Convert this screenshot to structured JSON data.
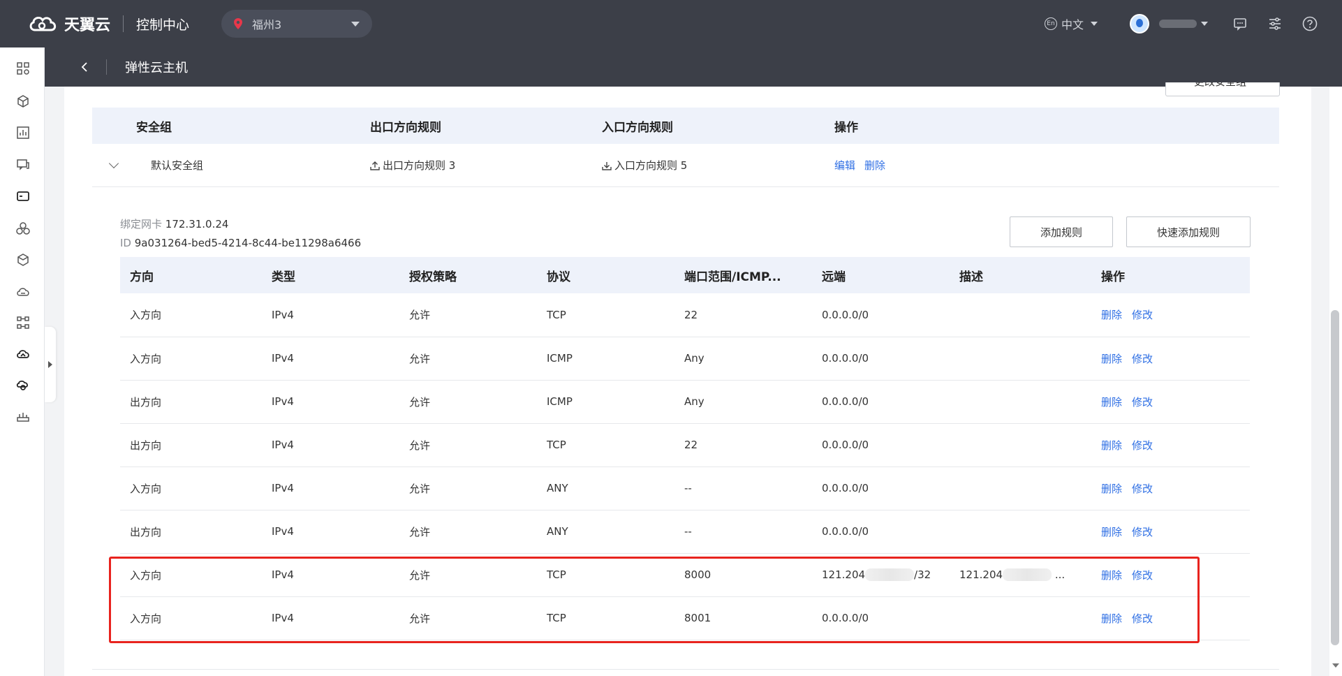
{
  "topbar": {
    "brand": "天翼云",
    "console_title": "控制中心",
    "region": "福州3",
    "language": "中文",
    "lang_badge": "En"
  },
  "subheader": {
    "title": "弹性云主机"
  },
  "top_button_partial": "更改安全组",
  "security_group": {
    "headers": [
      "安全组",
      "出口方向规则",
      "入口方向规则",
      "操作"
    ],
    "row": {
      "name": "默认安全组",
      "egress_rules": "出口方向规则 3",
      "ingress_rules": "入口方向规则 5",
      "edit": "编辑",
      "delete": "删除"
    }
  },
  "nic": {
    "label": "绑定网卡",
    "ip": "172.31.0.24",
    "id_label": "ID",
    "id": "9a031264-bed5-4214-8c44-be11298a6466"
  },
  "buttons": {
    "add_rule": "添加规则",
    "quick_add_rule": "快速添加规则"
  },
  "rules_table": {
    "headers": [
      "方向",
      "类型",
      "授权策略",
      "协议",
      "端口范围/ICMP...",
      "远端",
      "描述",
      "操作"
    ],
    "delete_label": "删除",
    "modify_label": "修改",
    "rows": [
      {
        "direction": "入方向",
        "type": "IPv4",
        "policy": "允许",
        "protocol": "TCP",
        "port": "22",
        "remote": "0.0.0.0/0",
        "remote_suffix": "",
        "desc": "",
        "desc_suffix": ""
      },
      {
        "direction": "入方向",
        "type": "IPv4",
        "policy": "允许",
        "protocol": "ICMP",
        "port": "Any",
        "remote": "0.0.0.0/0",
        "remote_suffix": "",
        "desc": "",
        "desc_suffix": ""
      },
      {
        "direction": "出方向",
        "type": "IPv4",
        "policy": "允许",
        "protocol": "ICMP",
        "port": "Any",
        "remote": "0.0.0.0/0",
        "remote_suffix": "",
        "desc": "",
        "desc_suffix": ""
      },
      {
        "direction": "出方向",
        "type": "IPv4",
        "policy": "允许",
        "protocol": "TCP",
        "port": "22",
        "remote": "0.0.0.0/0",
        "remote_suffix": "",
        "desc": "",
        "desc_suffix": ""
      },
      {
        "direction": "入方向",
        "type": "IPv4",
        "policy": "允许",
        "protocol": "ANY",
        "port": "--",
        "remote": "0.0.0.0/0",
        "remote_suffix": "",
        "desc": "",
        "desc_suffix": ""
      },
      {
        "direction": "出方向",
        "type": "IPv4",
        "policy": "允许",
        "protocol": "ANY",
        "port": "--",
        "remote": "0.0.0.0/0",
        "remote_suffix": "",
        "desc": "",
        "desc_suffix": ""
      },
      {
        "direction": "入方向",
        "type": "IPv4",
        "policy": "允许",
        "protocol": "TCP",
        "port": "8000",
        "remote": "121.204",
        "remote_suffix": "/32",
        "desc": "121.204",
        "desc_suffix": "..."
      },
      {
        "direction": "入方向",
        "type": "IPv4",
        "policy": "允许",
        "protocol": "TCP",
        "port": "8001",
        "remote": "0.0.0.0/0",
        "remote_suffix": "",
        "desc": "",
        "desc_suffix": ""
      }
    ]
  },
  "colors": {
    "topbar_bg": "#3c3f48",
    "link": "#2f6fe4",
    "header_row_bg": "#eef2fa",
    "highlight_border": "#e8231e"
  },
  "icons": {
    "sidebar": [
      "dashboard-icon",
      "cube-icon",
      "chart-icon",
      "message-icon",
      "server-icon",
      "cluster-icon",
      "box-icon",
      "cloud-storage-icon",
      "network-icon",
      "cloud-sync-icon",
      "security-icon",
      "database-icon"
    ],
    "topbar": [
      "message-icon",
      "settings-sliders-icon",
      "help-icon"
    ]
  }
}
